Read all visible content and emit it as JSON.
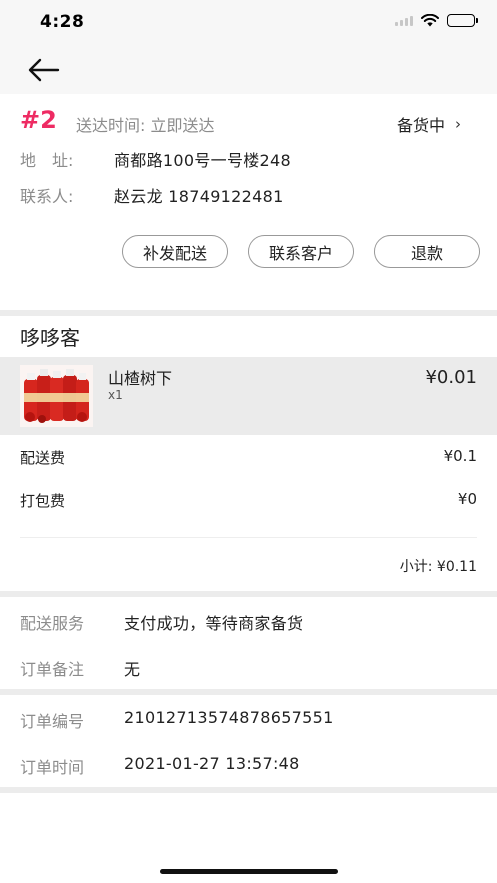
{
  "status_bar": {
    "time": "4:28"
  },
  "order": {
    "number": "#2",
    "delivery_time": "送达时间: 立即送达",
    "status": "备货中",
    "address_label": "地　址:",
    "address_value": "商都路100号一号楼248",
    "contact_label": "联系人:",
    "contact_value": "赵云龙  18749122481"
  },
  "actions": {
    "resend": "补发配送",
    "contact_customer": "联系客户",
    "refund": "退款"
  },
  "store": {
    "name": "哆哆客",
    "items": [
      {
        "name": "山楂树下",
        "qty": "x1",
        "price": "¥0.01"
      }
    ]
  },
  "fees": {
    "delivery_label": "配送费",
    "delivery_value": "¥0.1",
    "packing_label": "打包费",
    "packing_value": "¥0",
    "subtotal": "小计: ¥0.11"
  },
  "service": {
    "delivery_service_label": "配送服务",
    "delivery_service_value": "支付成功，等待商家备货",
    "remark_label": "订单备注",
    "remark_value": "无"
  },
  "order_meta": {
    "id_label": "订单编号",
    "id_value": "21012713574878657551",
    "time_label": "订单时间",
    "time_value": "2021-01-27 13:57:48"
  },
  "colors": {
    "accent": "#ee2b63",
    "muted_text": "#8c8c8c",
    "divider": "#ececec",
    "item_bg": "#ebebeb"
  },
  "icons": [
    "signal-icon",
    "wifi-icon",
    "battery-icon",
    "back-arrow-icon",
    "chevron-right-icon",
    "product-thumbnail"
  ]
}
